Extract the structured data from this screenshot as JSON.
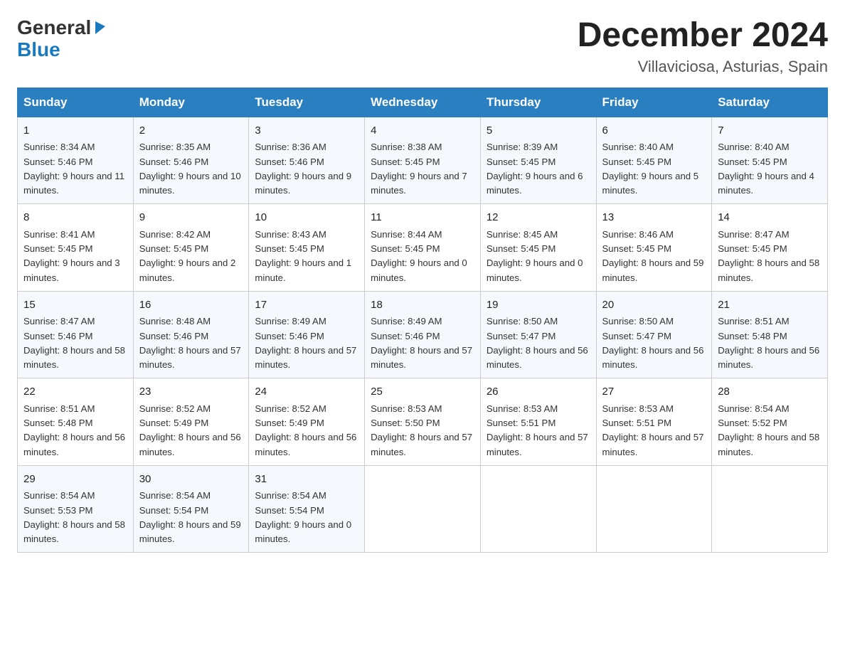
{
  "logo": {
    "general": "General",
    "triangle": "▶",
    "blue": "Blue"
  },
  "title": "December 2024",
  "location": "Villaviciosa, Asturias, Spain",
  "days_of_week": [
    "Sunday",
    "Monday",
    "Tuesday",
    "Wednesday",
    "Thursday",
    "Friday",
    "Saturday"
  ],
  "weeks": [
    [
      {
        "day": "1",
        "sunrise": "8:34 AM",
        "sunset": "5:46 PM",
        "daylight": "9 hours and 11 minutes."
      },
      {
        "day": "2",
        "sunrise": "8:35 AM",
        "sunset": "5:46 PM",
        "daylight": "9 hours and 10 minutes."
      },
      {
        "day": "3",
        "sunrise": "8:36 AM",
        "sunset": "5:46 PM",
        "daylight": "9 hours and 9 minutes."
      },
      {
        "day": "4",
        "sunrise": "8:38 AM",
        "sunset": "5:45 PM",
        "daylight": "9 hours and 7 minutes."
      },
      {
        "day": "5",
        "sunrise": "8:39 AM",
        "sunset": "5:45 PM",
        "daylight": "9 hours and 6 minutes."
      },
      {
        "day": "6",
        "sunrise": "8:40 AM",
        "sunset": "5:45 PM",
        "daylight": "9 hours and 5 minutes."
      },
      {
        "day": "7",
        "sunrise": "8:40 AM",
        "sunset": "5:45 PM",
        "daylight": "9 hours and 4 minutes."
      }
    ],
    [
      {
        "day": "8",
        "sunrise": "8:41 AM",
        "sunset": "5:45 PM",
        "daylight": "9 hours and 3 minutes."
      },
      {
        "day": "9",
        "sunrise": "8:42 AM",
        "sunset": "5:45 PM",
        "daylight": "9 hours and 2 minutes."
      },
      {
        "day": "10",
        "sunrise": "8:43 AM",
        "sunset": "5:45 PM",
        "daylight": "9 hours and 1 minute."
      },
      {
        "day": "11",
        "sunrise": "8:44 AM",
        "sunset": "5:45 PM",
        "daylight": "9 hours and 0 minutes."
      },
      {
        "day": "12",
        "sunrise": "8:45 AM",
        "sunset": "5:45 PM",
        "daylight": "9 hours and 0 minutes."
      },
      {
        "day": "13",
        "sunrise": "8:46 AM",
        "sunset": "5:45 PM",
        "daylight": "8 hours and 59 minutes."
      },
      {
        "day": "14",
        "sunrise": "8:47 AM",
        "sunset": "5:45 PM",
        "daylight": "8 hours and 58 minutes."
      }
    ],
    [
      {
        "day": "15",
        "sunrise": "8:47 AM",
        "sunset": "5:46 PM",
        "daylight": "8 hours and 58 minutes."
      },
      {
        "day": "16",
        "sunrise": "8:48 AM",
        "sunset": "5:46 PM",
        "daylight": "8 hours and 57 minutes."
      },
      {
        "day": "17",
        "sunrise": "8:49 AM",
        "sunset": "5:46 PM",
        "daylight": "8 hours and 57 minutes."
      },
      {
        "day": "18",
        "sunrise": "8:49 AM",
        "sunset": "5:46 PM",
        "daylight": "8 hours and 57 minutes."
      },
      {
        "day": "19",
        "sunrise": "8:50 AM",
        "sunset": "5:47 PM",
        "daylight": "8 hours and 56 minutes."
      },
      {
        "day": "20",
        "sunrise": "8:50 AM",
        "sunset": "5:47 PM",
        "daylight": "8 hours and 56 minutes."
      },
      {
        "day": "21",
        "sunrise": "8:51 AM",
        "sunset": "5:48 PM",
        "daylight": "8 hours and 56 minutes."
      }
    ],
    [
      {
        "day": "22",
        "sunrise": "8:51 AM",
        "sunset": "5:48 PM",
        "daylight": "8 hours and 56 minutes."
      },
      {
        "day": "23",
        "sunrise": "8:52 AM",
        "sunset": "5:49 PM",
        "daylight": "8 hours and 56 minutes."
      },
      {
        "day": "24",
        "sunrise": "8:52 AM",
        "sunset": "5:49 PM",
        "daylight": "8 hours and 56 minutes."
      },
      {
        "day": "25",
        "sunrise": "8:53 AM",
        "sunset": "5:50 PM",
        "daylight": "8 hours and 57 minutes."
      },
      {
        "day": "26",
        "sunrise": "8:53 AM",
        "sunset": "5:51 PM",
        "daylight": "8 hours and 57 minutes."
      },
      {
        "day": "27",
        "sunrise": "8:53 AM",
        "sunset": "5:51 PM",
        "daylight": "8 hours and 57 minutes."
      },
      {
        "day": "28",
        "sunrise": "8:54 AM",
        "sunset": "5:52 PM",
        "daylight": "8 hours and 58 minutes."
      }
    ],
    [
      {
        "day": "29",
        "sunrise": "8:54 AM",
        "sunset": "5:53 PM",
        "daylight": "8 hours and 58 minutes."
      },
      {
        "day": "30",
        "sunrise": "8:54 AM",
        "sunset": "5:54 PM",
        "daylight": "8 hours and 59 minutes."
      },
      {
        "day": "31",
        "sunrise": "8:54 AM",
        "sunset": "5:54 PM",
        "daylight": "9 hours and 0 minutes."
      },
      null,
      null,
      null,
      null
    ]
  ]
}
